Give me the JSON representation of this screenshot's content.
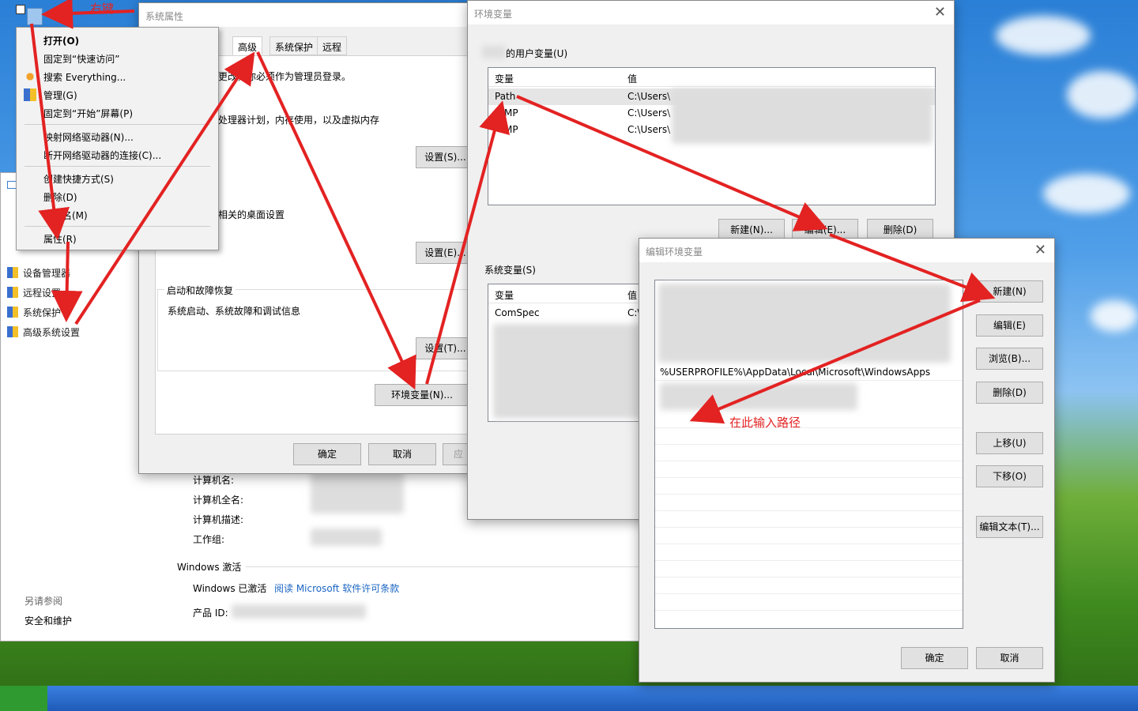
{
  "desktop": {
    "taskbar_color": "#1f5bb8"
  },
  "system_window": {
    "side_links": [
      "设备管理器",
      "远程设置",
      "系统保护",
      "高级系统设置"
    ],
    "see_also_title": "另请参阅",
    "see_also_link": "安全和维护",
    "info_labels": [
      "计算机名:",
      "计算机全名:",
      "计算机描述:",
      "工作组:"
    ],
    "activation_title": "Windows 激活",
    "activation_status": "Windows 已激活",
    "license_link": "阅读 Microsoft 软件许可条款",
    "product_id_label": "产品 ID:"
  },
  "context_menu": {
    "items": [
      "打开(O)",
      "固定到“快速访问”",
      "搜索 Everything...",
      "管理(G)",
      "固定到“开始”屏幕(P)",
      "映射网络驱动器(N)...",
      "断开网络驱动器的连接(C)...",
      "创建快捷方式(S)",
      "删除(D)",
      "重命名(M)",
      "属性(R)"
    ]
  },
  "sys_props": {
    "title": "系统属性",
    "tabs": [
      "高级",
      "系统保护",
      "远程"
    ],
    "admin_note": "更改，你必须作为管理员登录。",
    "perf_desc": "处理器计划，内存使用，以及虚拟内存",
    "profile_desc": "相关的桌面设置",
    "startup_title": "启动和故障恢复",
    "startup_desc": "系统启动、系统故障和调试信息",
    "settings1": "设置(S)...",
    "settings2": "设置(E)...",
    "settings3": "设置(T)...",
    "env_button": "环境变量(N)...",
    "ok": "确定",
    "cancel": "取消",
    "apply": "应"
  },
  "env_vars": {
    "title": "环境变量",
    "user_group": "的用户变量(U)",
    "col_var": "变量",
    "col_val": "值",
    "user_rows": [
      {
        "var": "Path",
        "val": "C:\\Users\\"
      },
      {
        "var": "MP",
        "val": "C:\\Users\\"
      },
      {
        "var": "MP",
        "val": "C:\\Users\\"
      }
    ],
    "new_btn": "新建(N)...",
    "edit_btn": "编辑(E)...",
    "delete_btn": "删除(D)",
    "sys_group": "系统变量(S)",
    "sys_rows": [
      {
        "var": "ComSpec",
        "val": "C:\\"
      }
    ]
  },
  "edit_env": {
    "title": "编辑环境变量",
    "path_entry": "%USERPROFILE%\\AppData\\Local\\Microsoft\\WindowsApps",
    "buttons": [
      "新建(N)",
      "编辑(E)",
      "浏览(B)...",
      "删除(D)",
      "上移(U)",
      "下移(O)",
      "编辑文本(T)..."
    ],
    "ok": "确定",
    "cancel": "取消"
  },
  "annotations": {
    "right_click": "右键",
    "input_path": "在此输入路径",
    "color": "#e32222"
  }
}
